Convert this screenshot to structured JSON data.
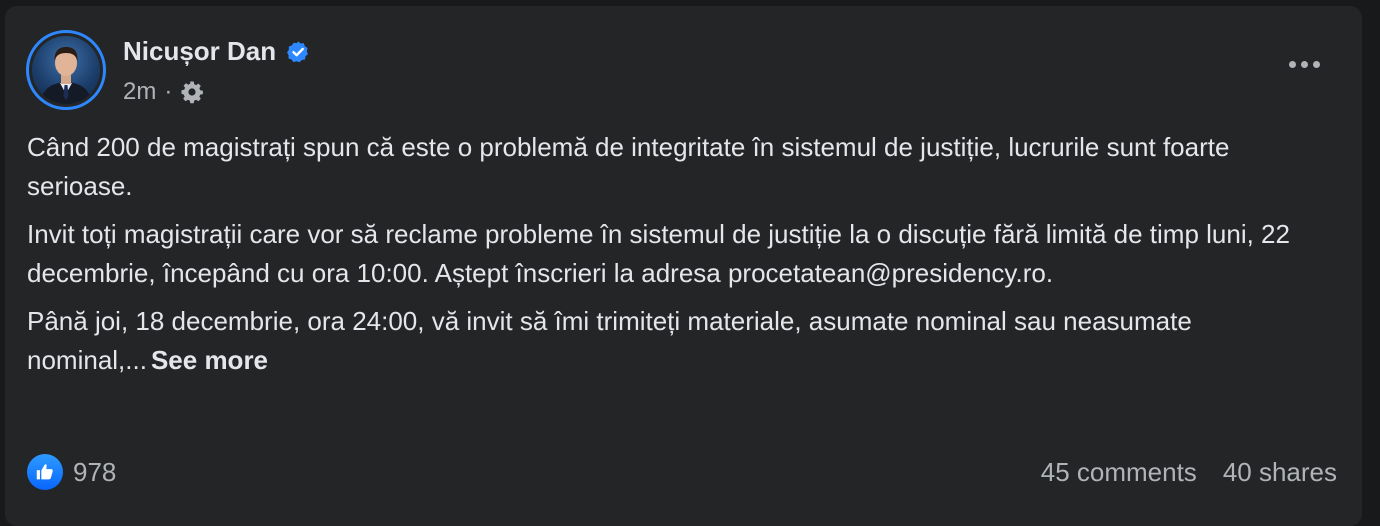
{
  "post": {
    "author": "Nicușor Dan",
    "time": "2m",
    "separator": "·",
    "paragraphs": [
      "Când 200 de magistrați spun că este o problemă de integritate în sistemul de justiție, lucrurile sunt foarte serioase.",
      "Invit toți magistrații care vor să reclame probleme în sistemul de justiție la o discuție fără limită de timp luni, 22 decembrie, începând cu ora 10:00. Aștept înscrieri la adresa procetatean@presidency.ro.",
      "Până joi, 18 decembrie, ora 24:00, vă invit să îmi trimiteți materiale, asumate nominal sau neasumate nominal,..."
    ],
    "see_more": "See more",
    "reactions_count": "978",
    "comments": "45 comments",
    "shares": "40 shares"
  },
  "icons": {
    "verified": "verified-badge-icon",
    "audience": "gear-icon",
    "more": "more-options-icon",
    "reaction": "like-icon"
  },
  "colors": {
    "card_bg": "#242526",
    "accent": "#2d88ff",
    "text_primary": "#e4e6eb",
    "text_secondary": "#b0b3b8"
  }
}
